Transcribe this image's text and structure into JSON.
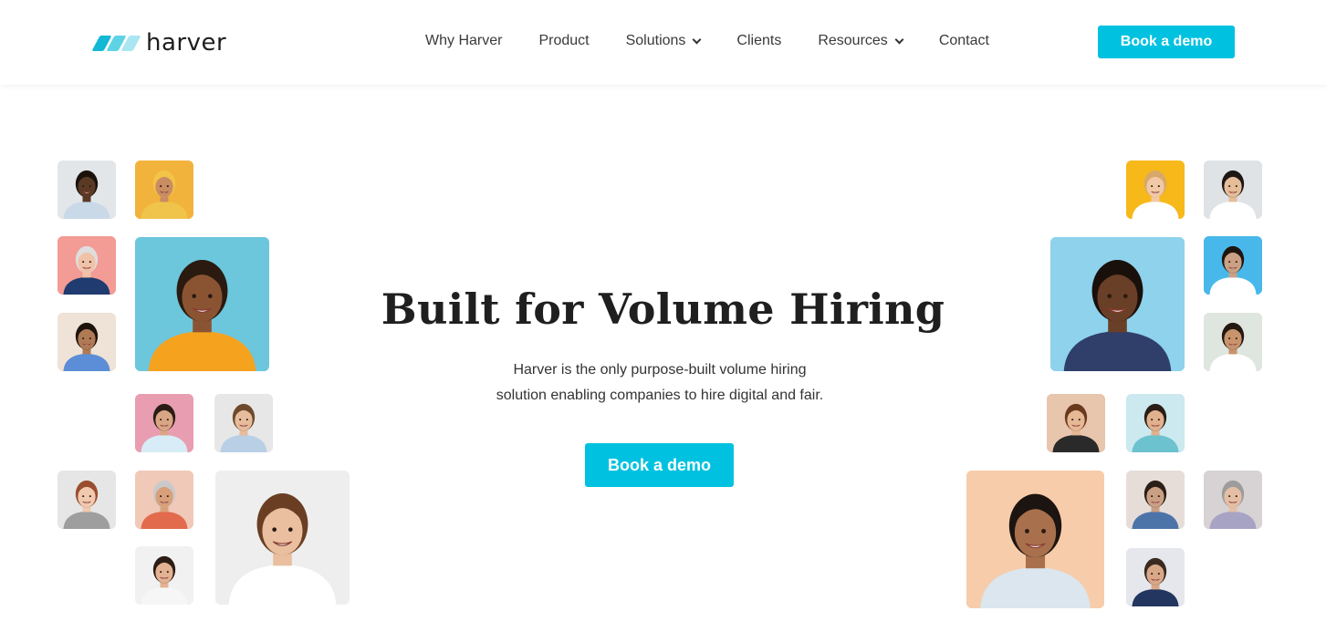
{
  "header": {
    "logo": {
      "text": "harver",
      "mark_colors": [
        "#12b8d4",
        "#5fd3e6",
        "#a9e6f1"
      ]
    },
    "nav": [
      {
        "label": "Why Harver",
        "has_dropdown": false
      },
      {
        "label": "Product",
        "has_dropdown": false
      },
      {
        "label": "Solutions",
        "has_dropdown": true
      },
      {
        "label": "Clients",
        "has_dropdown": false
      },
      {
        "label": "Resources",
        "has_dropdown": true
      },
      {
        "label": "Contact",
        "has_dropdown": false
      }
    ],
    "cta_label": "Book a demo"
  },
  "hero": {
    "title": "Built for Volume Hiring",
    "subtitle_lines": [
      "Harver is the only purpose-built volume hiring",
      "solution enabling companies to hire digital and fair."
    ],
    "cta_label": "Book a demo"
  },
  "colors": {
    "accent": "#00c2e0",
    "text": "#1f1f1f"
  },
  "portraits": [
    {
      "bg": "#e3e6e9",
      "skin": "#5a3a25",
      "hair": "#1b120c",
      "shirt": "#c9d9e8"
    },
    {
      "bg": "#f2b33d",
      "skin": "#c98c63",
      "hair": "#f3c447",
      "shirt": "#f0c44a"
    },
    {
      "bg": "#f39b95",
      "skin": "#f0c2a8",
      "hair": "#dedede",
      "shirt": "#1f3b6f"
    },
    {
      "bg": "#6cc6dc",
      "skin": "#8a5433",
      "hair": "#2a1a10",
      "shirt": "#f5a21e"
    },
    {
      "bg": "#efe2d6",
      "skin": "#b07a55",
      "hair": "#1e140d",
      "shirt": "#5b8ed6"
    },
    {
      "bg": "#e99db0",
      "skin": "#d9a685",
      "hair": "#2a1d15",
      "shirt": "#d7ecf6"
    },
    {
      "bg": "#e7e7e7",
      "skin": "#e6bc9c",
      "hair": "#6e4a2c",
      "shirt": "#b9cfe6"
    },
    {
      "bg": "#e6e6e6",
      "skin": "#f0c9ae",
      "hair": "#9a4e2f",
      "shirt": "#9e9e9e"
    },
    {
      "bg": "#f1c9b8",
      "skin": "#d8a07a",
      "hair": "#c9c9c9",
      "shirt": "#e26b4e"
    },
    {
      "bg": "#f1f1f1",
      "skin": "#e3b293",
      "hair": "#2c1c14",
      "shirt": "#f6f6f6"
    },
    {
      "bg": "#eeeeee",
      "skin": "#e9bf9f",
      "hair": "#6a3e23",
      "shirt": "#ffffff"
    },
    {
      "bg": "#f7b81a",
      "skin": "#f1c9a6",
      "hair": "#d7a86a",
      "shirt": "#ffffff"
    },
    {
      "bg": "#dfe3e6",
      "skin": "#e5bd99",
      "hair": "#1d1714",
      "shirt": "#ffffff"
    },
    {
      "bg": "#8ed2ec",
      "skin": "#6a3f27",
      "hair": "#1a100b",
      "shirt": "#2f3f6a"
    },
    {
      "bg": "#48b8ea",
      "skin": "#caa184",
      "hair": "#1f1510",
      "shirt": "#ffffff"
    },
    {
      "bg": "#dfe5df",
      "skin": "#c9946c",
      "hair": "#241812",
      "shirt": "#ffffff"
    },
    {
      "bg": "#e8c5ad",
      "skin": "#e7b894",
      "hair": "#6a3a1f",
      "shirt": "#2a2a2a"
    },
    {
      "bg": "#cbe9ef",
      "skin": "#e1b08e",
      "hair": "#2a1d15",
      "shirt": "#6cc2cf"
    },
    {
      "bg": "#f7ccaa",
      "skin": "#a8704c",
      "hair": "#1c1410",
      "shirt": "#dbe6ee"
    },
    {
      "bg": "#e6ddd9",
      "skin": "#caa084",
      "hair": "#2b1f18",
      "shirt": "#4d74a8"
    },
    {
      "bg": "#d7d2d4",
      "skin": "#e5bfa5",
      "hair": "#9c9c9c",
      "shirt": "#a7a3c4"
    },
    {
      "bg": "#e5e7ec",
      "skin": "#d8a888",
      "hair": "#3a2a20",
      "shirt": "#23365f"
    }
  ]
}
